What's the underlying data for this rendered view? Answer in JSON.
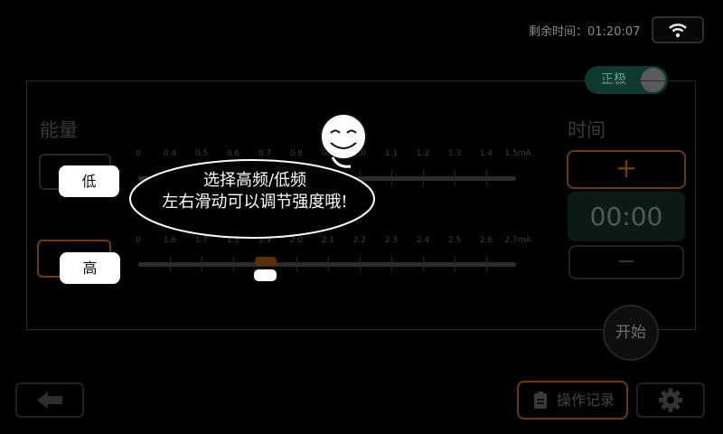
{
  "status": {
    "remaining_label": "剩余时间：01:20:07",
    "wifi_icon": "wifi-icon"
  },
  "polarity": {
    "label": "正极",
    "state": "on"
  },
  "energy": {
    "title": "能量",
    "low_scale": [
      "0",
      "0.4",
      "0.5",
      "0.6",
      "0.7",
      "0.8",
      "0.9",
      "1.0",
      "1.1",
      "1.2",
      "1.3",
      "1.4",
      "1.5mA"
    ],
    "high_scale": [
      "0",
      "1.6",
      "1.7",
      "1.8",
      "1.9",
      "2.0",
      "2.1",
      "2.2",
      "2.3",
      "2.4",
      "2.5",
      "2.6",
      "2.7mA"
    ],
    "high_slider_value": "1.9"
  },
  "timer": {
    "title": "时间",
    "plus_label": "+",
    "value": "00:00",
    "minus_label": "−"
  },
  "start_label": "开始",
  "footer": {
    "back_icon": "arrow-left-icon",
    "log_label": "操作记录",
    "log_icon": "clipboard-icon",
    "settings_icon": "gear-icon"
  },
  "tutorial": {
    "low_tag": "低",
    "high_tag": "高",
    "line1": "选择高频/低频",
    "line2": "左右滑动可以调节强度哦!",
    "mascot_icon": "smiley-mascot-icon"
  },
  "colors": {
    "accent_orange": "#6b3a10",
    "teal": "#0e3a32",
    "background": "#000000"
  }
}
